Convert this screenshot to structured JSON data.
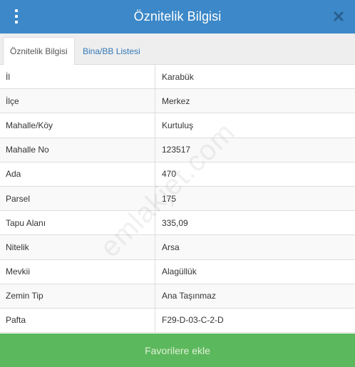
{
  "header": {
    "title": "Öznitelik Bilgisi"
  },
  "tabs": [
    {
      "label": "Öznitelik Bilgisi",
      "active": true
    },
    {
      "label": "Bina/BB Listesi",
      "active": false
    }
  ],
  "attributes": [
    {
      "key": "İl",
      "value": "Karabük"
    },
    {
      "key": "İlçe",
      "value": "Merkez"
    },
    {
      "key": "Mahalle/Köy",
      "value": "Kurtuluş"
    },
    {
      "key": "Mahalle No",
      "value": "123517"
    },
    {
      "key": "Ada",
      "value": "470"
    },
    {
      "key": "Parsel",
      "value": "175"
    },
    {
      "key": "Tapu Alanı",
      "value": "335,09"
    },
    {
      "key": "Nitelik",
      "value": "Arsa"
    },
    {
      "key": "Mevkii",
      "value": "Alagüllük"
    },
    {
      "key": "Zemin Tip",
      "value": "Ana Taşınmaz"
    },
    {
      "key": "Pafta",
      "value": "F29-D-03-C-2-D"
    }
  ],
  "watermark": "emlakjet.com",
  "footer": {
    "button_label": "Favorilere ekle"
  },
  "colors": {
    "header": "#3c88c8",
    "footer": "#5cb85c",
    "tab_link": "#3478b6"
  },
  "icons": {
    "menu": "vertical-dots-icon",
    "close": "close-icon"
  }
}
